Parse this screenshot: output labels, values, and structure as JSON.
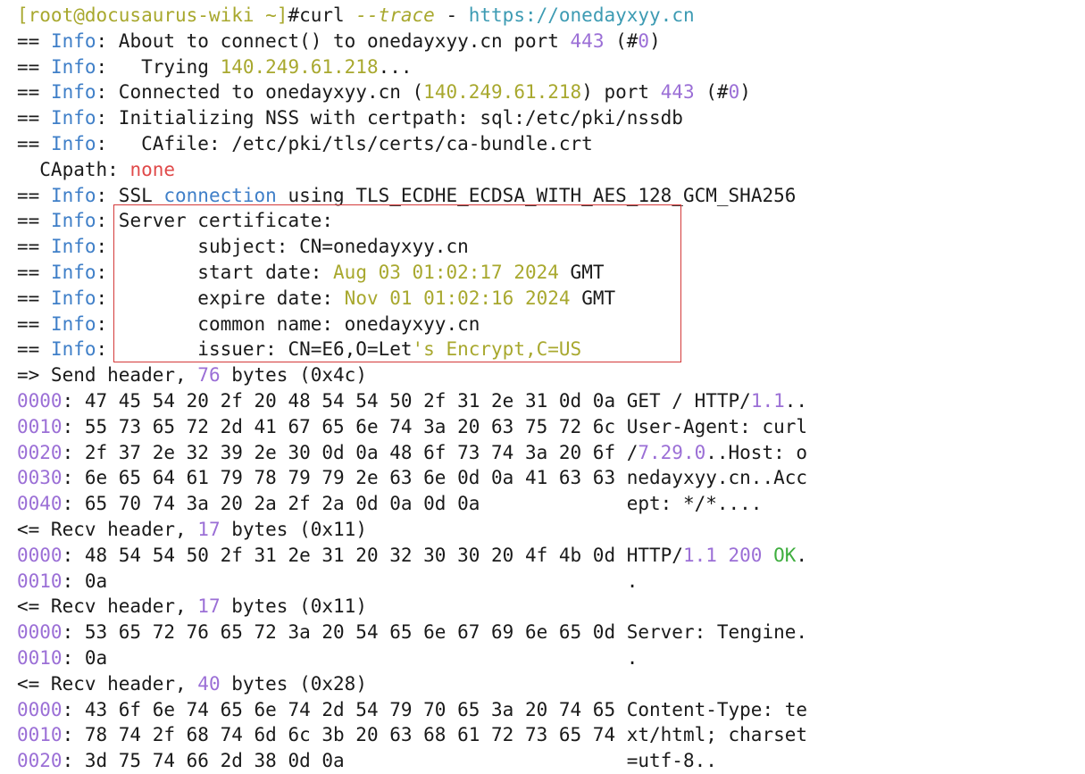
{
  "colors": {
    "default": "#1a1a1a",
    "yellow": "#a8a82e",
    "purple": "#9b6fd6",
    "blue": "#3f7fc8",
    "teal": "#3d9bb3",
    "red": "#e04a4a",
    "green": "#3fae3f",
    "highlight_border": "#d43a3a"
  },
  "terminal": {
    "lines": [
      [
        [
          "[root@docusaurus-wiki ~]",
          "yellow"
        ],
        [
          "#curl ",
          "default"
        ],
        [
          "--trace",
          "yellow italic"
        ],
        [
          " - ",
          "default"
        ],
        [
          "https://onedayxyy.cn",
          "teal"
        ]
      ],
      [
        [
          "== ",
          "default"
        ],
        [
          "Info",
          "blue"
        ],
        [
          ": About to connect() to onedayxyy.cn port ",
          "default"
        ],
        [
          "443",
          "purple"
        ],
        [
          " (#",
          "default"
        ],
        [
          "0",
          "purple"
        ],
        [
          ")",
          "default"
        ]
      ],
      [
        [
          "== ",
          "default"
        ],
        [
          "Info",
          "blue"
        ],
        [
          ":   Trying ",
          "default"
        ],
        [
          "140.249.61.218",
          "yellow"
        ],
        [
          "...",
          "default"
        ]
      ],
      [
        [
          "== ",
          "default"
        ],
        [
          "Info",
          "blue"
        ],
        [
          ": Connected to onedayxyy.cn (",
          "default"
        ],
        [
          "140.249.61.218",
          "yellow"
        ],
        [
          ") port ",
          "default"
        ],
        [
          "443",
          "purple"
        ],
        [
          " (#",
          "default"
        ],
        [
          "0",
          "purple"
        ],
        [
          ")",
          "default"
        ]
      ],
      [
        [
          "== ",
          "default"
        ],
        [
          "Info",
          "blue"
        ],
        [
          ": Initializing NSS with certpath: sql:/etc/pki/nssdb",
          "default"
        ]
      ],
      [
        [
          "== ",
          "default"
        ],
        [
          "Info",
          "blue"
        ],
        [
          ":   CAfile: /etc/pki/tls/certs/ca-bundle.crt",
          "default"
        ]
      ],
      [
        [
          "  CApath: ",
          "default"
        ],
        [
          "none",
          "red"
        ]
      ],
      [
        [
          "== ",
          "default"
        ],
        [
          "Info",
          "blue"
        ],
        [
          ": SSL ",
          "default"
        ],
        [
          "connection",
          "blue"
        ],
        [
          " using TLS_ECDHE_ECDSA_WITH_AES_128_GCM_SHA256",
          "default"
        ]
      ],
      [
        [
          "== ",
          "default"
        ],
        [
          "Info",
          "blue"
        ],
        [
          ": Server certificate:",
          "default"
        ]
      ],
      [
        [
          "== ",
          "default"
        ],
        [
          "Info",
          "blue"
        ],
        [
          ":        subject: CN=onedayxyy.cn",
          "default"
        ]
      ],
      [
        [
          "== ",
          "default"
        ],
        [
          "Info",
          "blue"
        ],
        [
          ":        start date: ",
          "default"
        ],
        [
          "Aug 03 01:02:17 2024",
          "yellow"
        ],
        [
          " GMT",
          "default"
        ]
      ],
      [
        [
          "== ",
          "default"
        ],
        [
          "Info",
          "blue"
        ],
        [
          ":        expire date: ",
          "default"
        ],
        [
          "Nov 01 01:02:16 2024",
          "yellow"
        ],
        [
          " GMT",
          "default"
        ]
      ],
      [
        [
          "== ",
          "default"
        ],
        [
          "Info",
          "blue"
        ],
        [
          ":        common name: onedayxyy.cn",
          "default"
        ]
      ],
      [
        [
          "== ",
          "default"
        ],
        [
          "Info",
          "blue"
        ],
        [
          ":        issuer: CN=E6,O=Let",
          "default"
        ],
        [
          "'s Encrypt,C=US",
          "yellow"
        ]
      ],
      [
        [
          "=> Send header, ",
          "default"
        ],
        [
          "76",
          "purple"
        ],
        [
          " bytes (",
          "default"
        ],
        [
          "0x4c",
          "default"
        ],
        [
          ")",
          "default"
        ]
      ],
      [
        [
          "0000",
          "purple"
        ],
        [
          ": 47 45 54 20 2f 20 48 54 54 50 2f 31 2e 31 0d 0a GET / HTTP/",
          "default"
        ],
        [
          "1.1",
          "purple"
        ],
        [
          "..",
          "default"
        ]
      ],
      [
        [
          "0010",
          "purple"
        ],
        [
          ": 55 73 65 72 2d 41 67 65 6e 74 3a 20 63 75 72 6c User-Agent: curl",
          "default"
        ]
      ],
      [
        [
          "0020",
          "purple"
        ],
        [
          ": 2f 37 2e 32 39 2e 30 0d 0a 48 6f 73 74 3a 20 6f /",
          "default"
        ],
        [
          "7.29.0",
          "purple"
        ],
        [
          "..Host: o",
          "default"
        ]
      ],
      [
        [
          "0030",
          "purple"
        ],
        [
          ": 6e 65 64 61 79 78 79 79 2e 63 6e 0d 0a 41 63 63 nedayxyy.cn..Acc",
          "default"
        ]
      ],
      [
        [
          "0040",
          "purple"
        ],
        [
          ": 65 70 74 3a 20 2a 2f 2a 0d 0a 0d 0a             ept: */*....",
          "default"
        ]
      ],
      [
        [
          "<= Recv header, ",
          "default"
        ],
        [
          "17",
          "purple"
        ],
        [
          " bytes (",
          "default"
        ],
        [
          "0x11",
          "default"
        ],
        [
          ")",
          "default"
        ]
      ],
      [
        [
          "0000",
          "purple"
        ],
        [
          ": 48 54 54 50 2f 31 2e 31 20 32 30 30 20 4f 4b 0d HTTP/",
          "default"
        ],
        [
          "1.1 200",
          "purple"
        ],
        [
          " ",
          "default"
        ],
        [
          "OK",
          "green"
        ],
        [
          ".",
          "default"
        ]
      ],
      [
        [
          "0010",
          "purple"
        ],
        [
          ": 0a                                              .",
          "default"
        ]
      ],
      [
        [
          "<= Recv header, ",
          "default"
        ],
        [
          "17",
          "purple"
        ],
        [
          " bytes (",
          "default"
        ],
        [
          "0x11",
          "default"
        ],
        [
          ")",
          "default"
        ]
      ],
      [
        [
          "0000",
          "purple"
        ],
        [
          ": 53 65 72 76 65 72 3a 20 54 65 6e 67 69 6e 65 0d Server: Tengine.",
          "default"
        ]
      ],
      [
        [
          "0010",
          "purple"
        ],
        [
          ": 0a                                              .",
          "default"
        ]
      ],
      [
        [
          "<= Recv header, ",
          "default"
        ],
        [
          "40",
          "purple"
        ],
        [
          " bytes (",
          "default"
        ],
        [
          "0x28",
          "default"
        ],
        [
          ")",
          "default"
        ]
      ],
      [
        [
          "0000",
          "purple"
        ],
        [
          ": 43 6f 6e 74 65 6e 74 2d 54 79 70 65 3a 20 74 65 Content-Type: te",
          "default"
        ]
      ],
      [
        [
          "0010",
          "purple"
        ],
        [
          ": 78 74 2f 68 74 6d 6c 3b 20 63 68 61 72 73 65 74 xt/html; charset",
          "default"
        ]
      ],
      [
        [
          "0020",
          "purple"
        ],
        [
          ": 3d 75 74 66 2d 38 0d 0a                         =utf-8..",
          "default"
        ]
      ]
    ]
  }
}
